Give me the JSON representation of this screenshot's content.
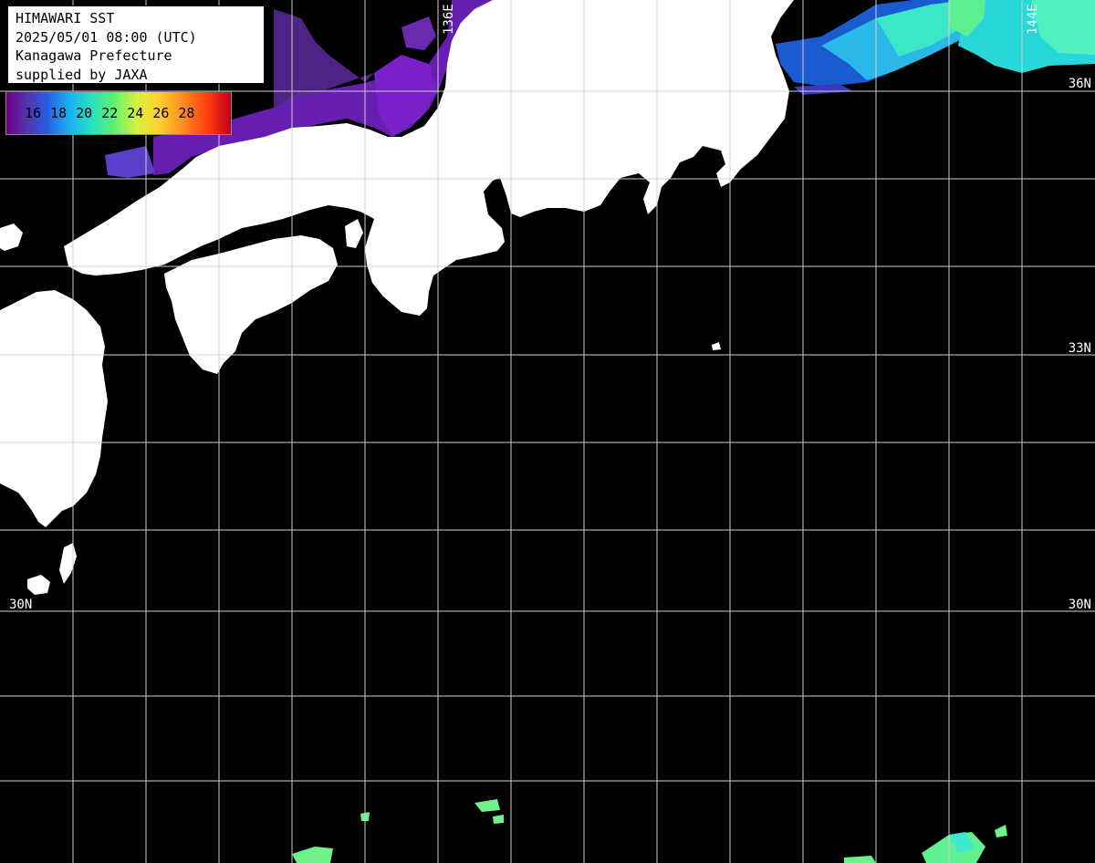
{
  "title_lines": [
    "HIMAWARI SST",
    "2025/05/01 08:00 (UTC)",
    "Kanagawa Prefecture",
    "supplied by JAXA"
  ],
  "scale": {
    "labels": [
      "16",
      "18",
      "20",
      "22",
      "24",
      "26",
      "28"
    ]
  },
  "lat_labels": {
    "n36": "36N",
    "n33": "33N",
    "n33_left": "33",
    "n30": "30N"
  },
  "lon_labels": {
    "e136": "136E",
    "e144": "144E"
  }
}
